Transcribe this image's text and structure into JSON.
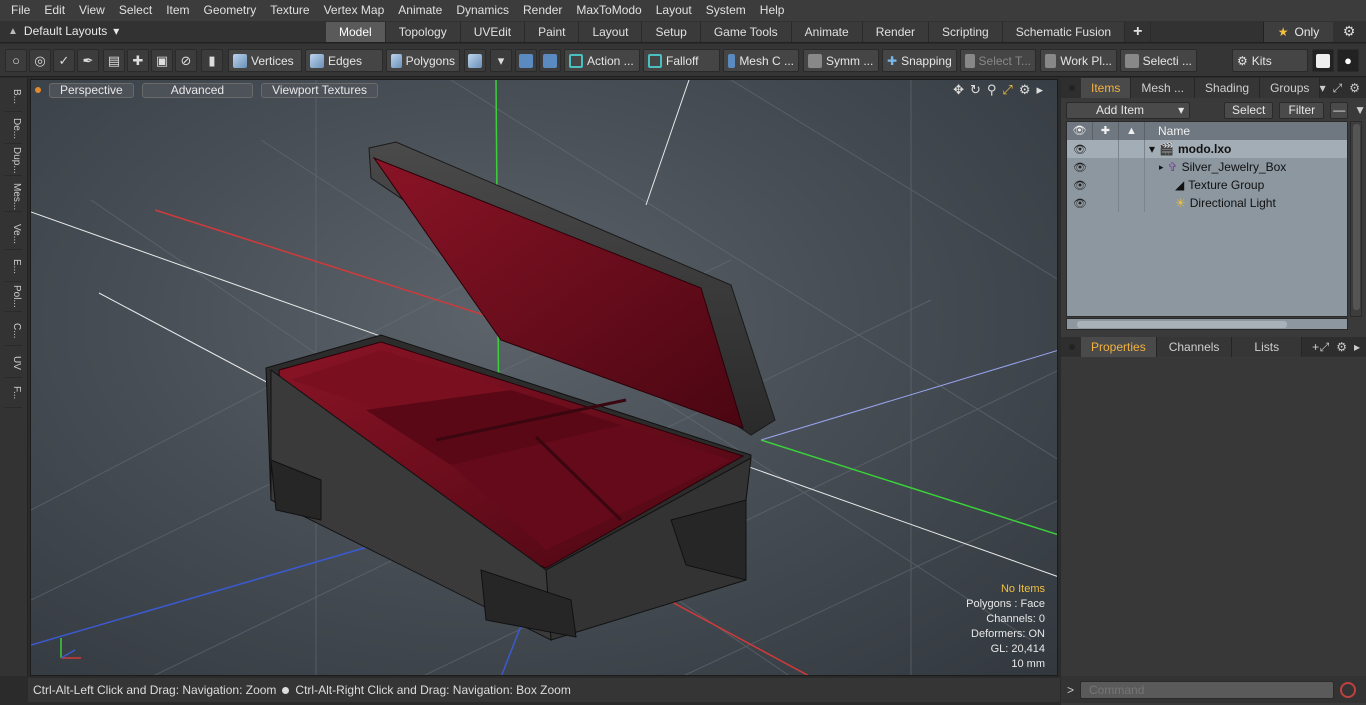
{
  "menu": [
    "File",
    "Edit",
    "View",
    "Select",
    "Item",
    "Geometry",
    "Texture",
    "Vertex Map",
    "Animate",
    "Dynamics",
    "Render",
    "MaxToModo",
    "Layout",
    "System",
    "Help"
  ],
  "layout": {
    "selector": "Default Layouts",
    "tabs": [
      "Model",
      "Topology",
      "UVEdit",
      "Paint",
      "Layout",
      "Setup",
      "Game Tools",
      "Animate",
      "Render",
      "Scripting",
      "Schematic Fusion"
    ],
    "active_tab": "Model",
    "add_tab": "+",
    "only_label": "Only"
  },
  "toolbar": {
    "vertices": "Vertices",
    "edges": "Edges",
    "polygons": "Polygons",
    "action": "Action ...",
    "falloff": "Falloff",
    "mesh_c": "Mesh C ...",
    "symm": "Symm ...",
    "snapping": "Snapping",
    "select_t": "Select T...",
    "work_pl": "Work Pl...",
    "selecti": "Selecti ...",
    "kits": "Kits"
  },
  "left_strip": [
    "B...",
    "De...",
    "Dup...",
    "Mes...",
    "Ve...",
    "E...",
    "Pol...",
    "C...",
    "UV",
    "F..."
  ],
  "viewport": {
    "perspective": "Perspective",
    "advanced": "Advanced",
    "viewport_textures": "Viewport Textures",
    "info": {
      "no_items": "No Items",
      "polygons": "Polygons : Face",
      "channels": "Channels: 0",
      "deformers": "Deformers: ON",
      "gl": "GL: 20,414",
      "unit": "10 mm"
    }
  },
  "status": {
    "left": "Ctrl-Alt-Left Click and Drag: Navigation: Zoom",
    "right": "Ctrl-Alt-Right Click and Drag: Navigation: Box Zoom"
  },
  "items_panel": {
    "tabs": [
      "Items",
      "Mesh ...",
      "Shading",
      "Groups"
    ],
    "active_tab": "Items",
    "add_item": "Add Item",
    "select": "Select",
    "filter": "Filter",
    "column_name": "Name",
    "rows": [
      {
        "name": "modo.lxo",
        "icon": "scene-icon",
        "bold": true,
        "level": 0
      },
      {
        "name": "Silver_Jewelry_Box",
        "icon": "mesh-icon",
        "bold": false,
        "level": 1
      },
      {
        "name": "Texture Group",
        "icon": "texture-group-icon",
        "bold": false,
        "level": 1
      },
      {
        "name": "Directional Light",
        "icon": "light-icon",
        "bold": false,
        "level": 1
      }
    ]
  },
  "props_panel": {
    "tabs": [
      "Properties",
      "Channels",
      "Lists"
    ],
    "active_tab": "Properties",
    "add": "+"
  },
  "command": {
    "placeholder": "Command"
  },
  "colors": {
    "accent": "#f2b240",
    "x_axis": "#d03a3a",
    "y_axis": "#3ad03a",
    "z_axis": "#3a5ad0",
    "velvet": "#6a0a18"
  }
}
